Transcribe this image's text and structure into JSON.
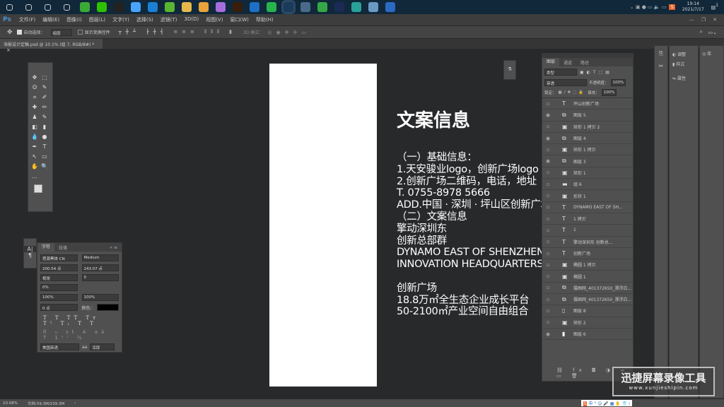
{
  "taskbar": {
    "time": "19:14",
    "date": "2021/7/17",
    "notification_count": "1",
    "apps": [
      "start",
      "search",
      "cortana",
      "task-view",
      "browser",
      "wechat",
      "qq",
      "baidu-netdisk",
      "app-blue",
      "app-green",
      "file-explorer",
      "chrome",
      "app-image",
      "illustrator",
      "app-outlook",
      "app-green2",
      "photoshop",
      "calculator",
      "app-green3",
      "cinema4d",
      "app-teal",
      "app-paper",
      "app-tencent"
    ]
  },
  "menubar": {
    "logo": "Ps",
    "items": [
      "文件(F)",
      "编辑(E)",
      "图像(I)",
      "图层(L)",
      "文字(Y)",
      "选择(S)",
      "滤镜(T)",
      "3D(D)",
      "视图(V)",
      "窗口(W)",
      "帮助(H)"
    ]
  },
  "options": {
    "auto_select_label": "自动选择：",
    "auto_select_value": "组层",
    "show_transform_label": "显示变换控件",
    "mode_3d_label": "3D 模式："
  },
  "document": {
    "tab_title": "海报设计定稿.psd @ 10.1% (组 7, RGB/8#) *"
  },
  "canvas_text": {
    "title": "文案信息",
    "lines": [
      "（一）基础信息：",
      "1.天安骏业logo，创新广场logo",
      "2.创新广场二维码，电话，地址",
      "T. 0755-8978 5666",
      "ADD.中国 · 深圳 · 坪山区创新广场",
      "（二）文案信息",
      "擎动深圳东",
      "创新总部群",
      "DYNAMO EAST OF SHENZHEN",
      "INNOVATION HEADQUARTERS GROUP",
      "",
      "创新广场",
      "18.8万㎡全生态企业成长平台",
      "50-2100㎡产业空间自由组合"
    ]
  },
  "character_panel": {
    "tabs": [
      "字符",
      "段落"
    ],
    "font_family": "思源黑体 CN",
    "font_style": "Medium",
    "font_size": "200.54 点",
    "leading": "243.07 点",
    "kerning": "视觉",
    "tracking": "0",
    "scale_tsume": "0%",
    "vertical_scale": "100%",
    "horizontal_scale": "100%",
    "baseline_shift": "0 点",
    "color_label": "颜色：",
    "text_color": "#000000",
    "language": "美国英语",
    "anti_alias": "浑厚",
    "aa_icon": "aa"
  },
  "layers_panel": {
    "tabs": [
      "图层",
      "通道",
      "路径"
    ],
    "filter": "类型",
    "blend_mode": "穿透",
    "opacity_label": "不透明度：",
    "opacity": "100%",
    "lock_label": "锁定：",
    "fill_label": "填充：",
    "fill": "100%",
    "layers": [
      {
        "type": "T",
        "name": "坪山创新广场",
        "visible": false
      },
      {
        "type": "smart",
        "name": "图层 5",
        "visible": true
      },
      {
        "type": "shape",
        "name": "矩形 1 拷贝 2",
        "visible": false
      },
      {
        "type": "smart",
        "name": "图层 4",
        "visible": true
      },
      {
        "type": "shape",
        "name": "矩形 1 拷贝",
        "visible": false
      },
      {
        "type": "smart",
        "name": "图层 3",
        "visible": true
      },
      {
        "type": "shape",
        "name": "矩形 1",
        "visible": false
      },
      {
        "type": "group",
        "name": "组 6",
        "visible": false
      },
      {
        "type": "shape",
        "name": "形状 1",
        "visible": false
      },
      {
        "type": "T",
        "name": "DYNAMO EAST OF SH...",
        "visible": false
      },
      {
        "type": "T",
        "name": "1 拷贝",
        "visible": false
      },
      {
        "type": "T",
        "name": "1",
        "visible": false
      },
      {
        "type": "T",
        "name": "擎动深圳东 创新总...",
        "visible": false
      },
      {
        "type": "T",
        "name": "创新广场",
        "visible": false
      },
      {
        "type": "shape",
        "name": "椭圆 1 拷贝",
        "visible": false
      },
      {
        "type": "shape",
        "name": "椭圆 1",
        "visible": false
      },
      {
        "type": "smart",
        "name": "摄图网_401372650_漂浮白...",
        "visible": false
      },
      {
        "type": "smart",
        "name": "摄图网_401372650_漂浮白...",
        "visible": false
      },
      {
        "type": "mask",
        "name": "图层 8",
        "visible": false
      },
      {
        "type": "shape",
        "name": "矩形 2",
        "visible": false
      },
      {
        "type": "pixel",
        "name": "图层 6",
        "visible": true
      }
    ]
  },
  "right_panels": {
    "adjust": "调整",
    "style": "样式",
    "library": "库",
    "properties": "属性"
  },
  "status": {
    "zoom": "10.08%",
    "doc_size": "文档:59.3M/239.3M"
  },
  "watermark": {
    "title": "迅捷屏幕录像工具",
    "url": "www.xunjieshipin.com"
  },
  "ime": {
    "label": "中"
  }
}
